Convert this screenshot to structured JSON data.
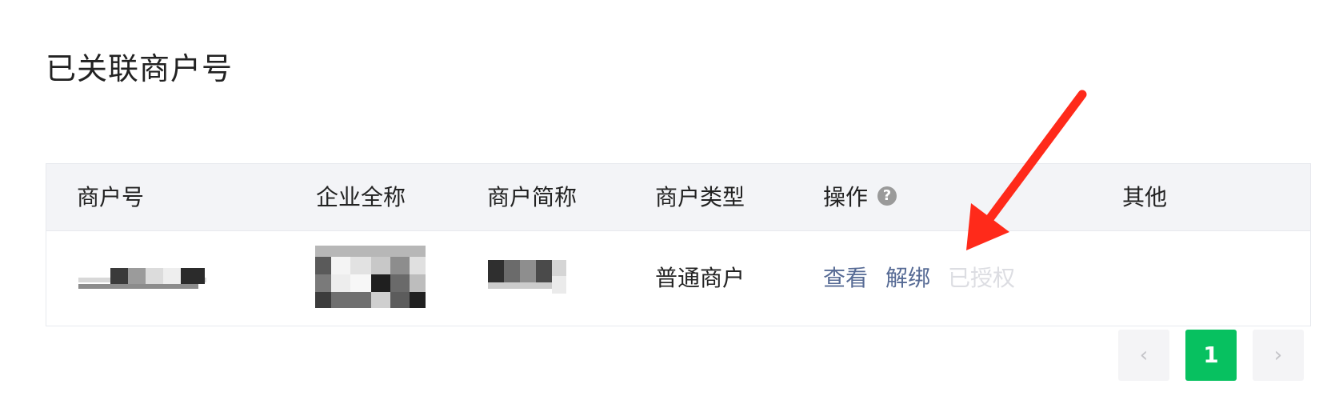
{
  "page": {
    "title": "已关联商户号"
  },
  "table": {
    "columns": [
      {
        "key": "merchant_id",
        "label": "商户号"
      },
      {
        "key": "company_name",
        "label": "企业全称"
      },
      {
        "key": "short_name",
        "label": "商户简称"
      },
      {
        "key": "merchant_type",
        "label": "商户类型"
      },
      {
        "key": "actions",
        "label": "操作"
      },
      {
        "key": "other",
        "label": "其他"
      }
    ],
    "help_icon_glyph": "?",
    "rows": [
      {
        "merchant_type": "普通商户",
        "actions": {
          "view": "查看",
          "unbind": "解绑",
          "authorized": "已授权"
        },
        "other": ""
      }
    ]
  },
  "pagination": {
    "prev_icon": "‹",
    "current_page": "1",
    "next_icon": "›"
  },
  "colors": {
    "accent_green": "#07c160",
    "link_blue": "#576b95",
    "annotation_arrow": "#ff2a1a"
  },
  "icons": {
    "help": "help-icon",
    "prev": "chevron-left-icon",
    "next": "chevron-right-icon",
    "annotation": "arrow-annotation-icon"
  }
}
